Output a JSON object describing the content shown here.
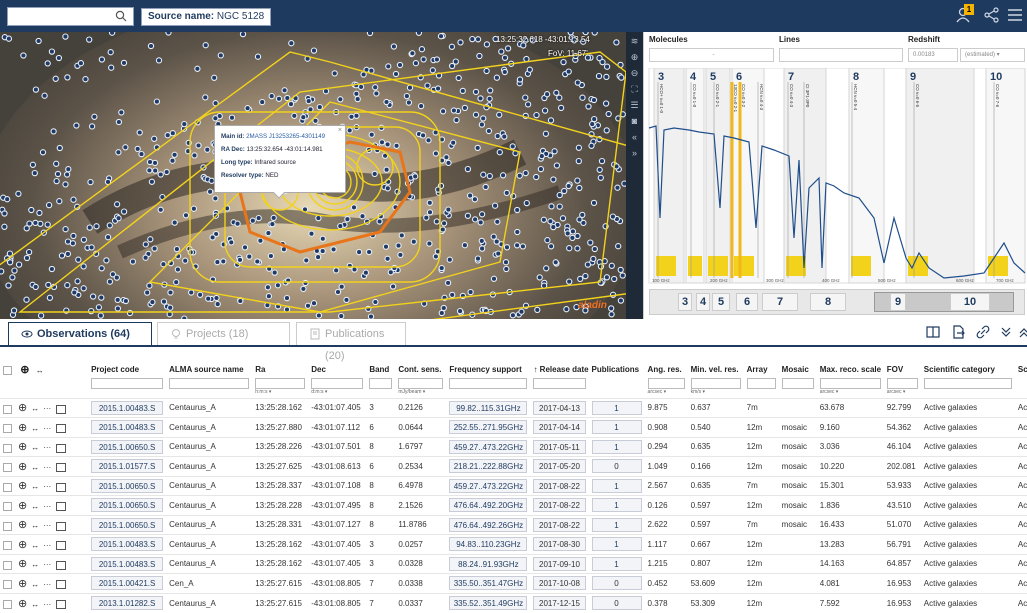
{
  "header": {
    "search_placeholder": "",
    "source_label": "Source name:",
    "source_value": "NGC 5128",
    "notification_count": "1"
  },
  "sky": {
    "coords": "13:25:32.618 -43:01:13.54",
    "fov": "FoV: 11.67'",
    "logo_text": "aladin",
    "popup": {
      "main_id_label": "Main id:",
      "main_id_value": "2MASS J13253265-4301149",
      "radec_label": "RA Dec:",
      "radec_value": "13:25:32.654 -43:01:14.981",
      "long_type_label": "Long type:",
      "long_type_value": "Infrared source",
      "resolver_label": "Resolver type:",
      "resolver_value": "NED",
      "close": "×"
    }
  },
  "spectral": {
    "molecules_label": "Molecules",
    "molecules_value": "-",
    "lines_label": "Lines",
    "redshift_label": "Redshift",
    "redshift_value": "0.00183",
    "redshift_mode": "(estimated) ▾",
    "band_numbers": [
      "3",
      "4",
      "5",
      "6",
      "7",
      "8",
      "9",
      "10"
    ],
    "freq_ticks": [
      "100 GHz",
      "200 GHz",
      "300 GHz",
      "400 GHz",
      "500 GHz",
      "600 GHz",
      "700 GHz"
    ],
    "line_labels": [
      "HCO+ v=0 1-0",
      "CO v=0 1-0",
      "CO v=0 2-1",
      "13CO v=0 2-1",
      "CO v=0 3-2",
      "HCN v=0 4-3",
      "CO v=0 4-3",
      "CI 3P1-3P0",
      "HCN v=0 5-4",
      "CO v=0 6-5",
      "CO v=0 7-6"
    ]
  },
  "tabs": {
    "observations": "Observations (64)",
    "projects": "Projects (18)",
    "publications": "Publications (20)"
  },
  "table": {
    "headers": [
      "Project code",
      "ALMA source name",
      "Ra",
      "Dec",
      "Band",
      "Cont. sens.",
      "Frequency support",
      "↑ Release date",
      "Publications",
      "Ang. res.",
      "Min. vel. res.",
      "Array",
      "Mosaic",
      "Max. reco. scale",
      "FOV",
      "Scientific category",
      "Sc"
    ],
    "units": [
      "",
      "",
      "h:m:s ▾",
      "d:m:s ▾",
      "",
      "mJy/beam ▾",
      "",
      "",
      "",
      "arcsec ▾",
      "km/s ▾",
      "",
      "",
      "arcsec ▾",
      "arcsec ▾",
      "",
      ""
    ],
    "rows": [
      [
        "2015.1.00483.S",
        "Centaurus_A",
        "13:25:28.162",
        "-43:01:07.405",
        "3",
        "0.2126",
        "99.82..115.31GHz",
        "2017-04-13",
        "1",
        "9.875",
        "0.637",
        "7m",
        "",
        "63.678",
        "92.799",
        "Active galaxies",
        "Ac"
      ],
      [
        "2015.1.00483.S",
        "Centaurus_A",
        "13:25:27.880",
        "-43:01:07.112",
        "6",
        "0.0644",
        "252.55..271.95GHz",
        "2017-04-14",
        "1",
        "0.908",
        "0.540",
        "12m",
        "mosaic",
        "9.160",
        "54.362",
        "Active galaxies",
        "Ac"
      ],
      [
        "2015.1.00650.S",
        "Centaurus_A",
        "13:25:28.226",
        "-43:01:07.501",
        "8",
        "1.6797",
        "459.27..473.22GHz",
        "2017-05-11",
        "1",
        "0.294",
        "0.635",
        "12m",
        "mosaic",
        "3.036",
        "46.104",
        "Active galaxies",
        "Ac"
      ],
      [
        "2015.1.01577.S",
        "Centaurus_A",
        "13:25:27.625",
        "-43:01:08.613",
        "6",
        "0.2534",
        "218.21..222.88GHz",
        "2017-05-20",
        "0",
        "1.049",
        "0.166",
        "12m",
        "mosaic",
        "10.220",
        "202.081",
        "Active galaxies",
        "Ac"
      ],
      [
        "2015.1.00650.S",
        "Centaurus_A",
        "13:25:28.337",
        "-43:01:07.108",
        "8",
        "6.4978",
        "459.27..473.22GHz",
        "2017-08-22",
        "1",
        "2.567",
        "0.635",
        "7m",
        "mosaic",
        "15.301",
        "53.933",
        "Active galaxies",
        "Ac"
      ],
      [
        "2015.1.00650.S",
        "Centaurus_A",
        "13:25:28.228",
        "-43:01:07.495",
        "8",
        "2.1526",
        "476.64..492.20GHz",
        "2017-08-22",
        "1",
        "0.126",
        "0.597",
        "12m",
        "mosaic",
        "1.836",
        "43.510",
        "Active galaxies",
        "Ac"
      ],
      [
        "2015.1.00650.S",
        "Centaurus_A",
        "13:25:28.331",
        "-43:01:07.127",
        "8",
        "11.8786",
        "476.64..492.26GHz",
        "2017-08-22",
        "1",
        "2.622",
        "0.597",
        "7m",
        "mosaic",
        "16.433",
        "51.070",
        "Active galaxies",
        "Ac"
      ],
      [
        "2015.1.00483.S",
        "Centaurus_A",
        "13:25:28.162",
        "-43:01:07.405",
        "3",
        "0.0257",
        "94.83..110.23GHz",
        "2017-08-30",
        "1",
        "1.117",
        "0.667",
        "12m",
        "",
        "13.283",
        "56.791",
        "Active galaxies",
        "Ac"
      ],
      [
        "2015.1.00483.S",
        "Centaurus_A",
        "13:25:28.162",
        "-43:01:07.405",
        "3",
        "0.0328",
        "88.24..91.93GHz",
        "2017-09-10",
        "1",
        "1.215",
        "0.807",
        "12m",
        "",
        "14.163",
        "64.857",
        "Active galaxies",
        "Ac"
      ],
      [
        "2015.1.00421.S",
        "Cen_A",
        "13:25:27.615",
        "-43:01:08.805",
        "7",
        "0.0338",
        "335.50..351.47GHz",
        "2017-10-08",
        "0",
        "0.452",
        "53.609",
        "12m",
        "",
        "4.081",
        "16.953",
        "Active galaxies",
        "Ac"
      ],
      [
        "2013.1.01282.S",
        "Centaurus_A",
        "13:25:27.615",
        "-43:01:08.805",
        "7",
        "0.0337",
        "335.52..351.49GHz",
        "2017-12-15",
        "0",
        "0.378",
        "53.309",
        "12m",
        "",
        "7.592",
        "16.953",
        "Active galaxies",
        "Ac"
      ]
    ]
  },
  "colors": {
    "brand": "#1f3a5f",
    "accent": "#f4b400",
    "footprint": "#f2d21b",
    "highlight": "#e8751a"
  }
}
